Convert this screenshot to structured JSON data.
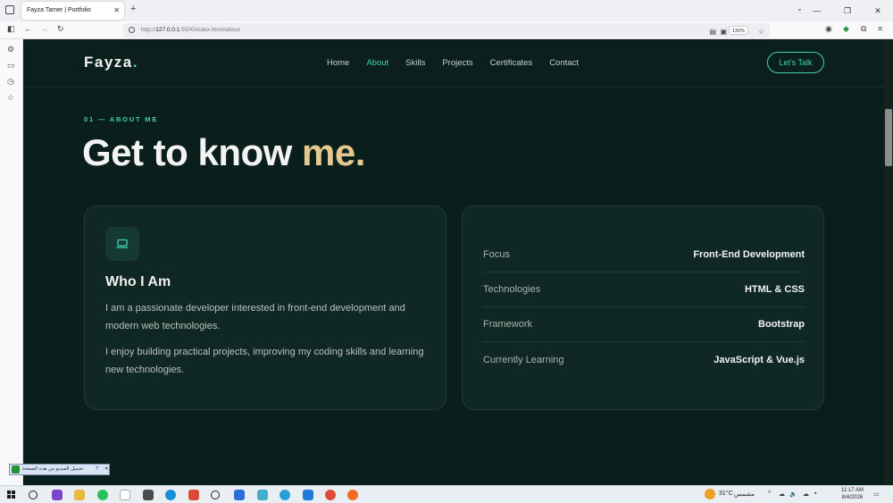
{
  "browser": {
    "tab_title": "Fayza Tamer | Portfolio",
    "tab_close": "✕",
    "new_tab": "+",
    "url_prefix": "http://",
    "url_host": "127.0.0.1",
    "url_rest": ":5500/index.html#about",
    "zoom": "130%"
  },
  "site": {
    "logo": "Fayza",
    "logo_dot": ".",
    "nav": [
      {
        "label": "Home"
      },
      {
        "label": "About"
      },
      {
        "label": "Skills"
      },
      {
        "label": "Projects"
      },
      {
        "label": "Certificates"
      },
      {
        "label": "Contact"
      }
    ],
    "cta": "Let's Talk",
    "eyebrow": "01 — ABOUT ME",
    "headline_main": "Get to know ",
    "headline_accent": "me.",
    "who": {
      "title": "Who I Am",
      "p1": "I am a passionate developer interested in front-end development and modern web technologies.",
      "p2": "I enjoy building practical projects, improving my coding skills and learning new technologies."
    },
    "info": [
      {
        "key": "Focus",
        "value": "Front-End Development"
      },
      {
        "key": "Technologies",
        "value": "HTML & CSS"
      },
      {
        "key": "Framework",
        "value": "Bootstrap"
      },
      {
        "key": "Currently Learning",
        "value": "JavaScript & Vue.js"
      }
    ]
  },
  "widget": {
    "text": "تحميل الفيديو من هذه الصفحة",
    "help": "?",
    "close": "✕"
  },
  "taskbar": {
    "temp": "31°C",
    "weather": "مشمس",
    "time": "11:17 AM",
    "date": "8/4/2026"
  },
  "colors": {
    "page_bg": "#0a1f1b",
    "accent_teal": "#3fd3b0",
    "accent_gold": "#e6c98f"
  }
}
